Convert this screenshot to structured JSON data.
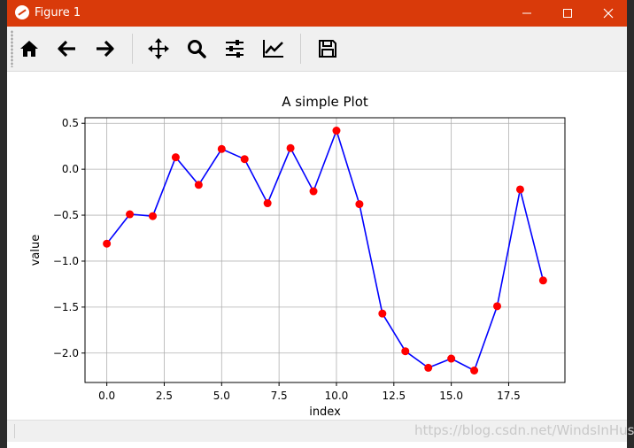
{
  "window": {
    "title": "Figure 1",
    "controls": {
      "minimize": "─",
      "maximize": "☐",
      "close": "✕"
    }
  },
  "toolbar": {
    "buttons": [
      {
        "name": "home-icon"
      },
      {
        "name": "back-arrow-icon"
      },
      {
        "name": "forward-arrow-icon"
      },
      {
        "name": "pan-icon"
      },
      {
        "name": "zoom-icon"
      },
      {
        "name": "subplots-config-icon"
      },
      {
        "name": "edit-axis-icon"
      },
      {
        "name": "save-icon"
      }
    ]
  },
  "status": {
    "watermark": "https://blog.csdn.net/WindsInHust"
  },
  "colors": {
    "titlebar": "#d93a0a",
    "line": "#0000ff",
    "marker": "#ff0000",
    "grid": "#b0b0b0"
  },
  "chart_data": {
    "type": "line",
    "title": "A simple Plot",
    "xlabel": "index",
    "ylabel": "value",
    "xlim": [
      -0.95,
      19.95
    ],
    "ylim": [
      -2.32,
      0.56
    ],
    "xticks": [
      0.0,
      2.5,
      5.0,
      7.5,
      10.0,
      12.5,
      15.0,
      17.5
    ],
    "xtick_labels": [
      "0.0",
      "2.5",
      "5.0",
      "7.5",
      "10.0",
      "12.5",
      "15.0",
      "17.5"
    ],
    "yticks": [
      0.5,
      0.0,
      -0.5,
      -1.0,
      -1.5,
      -2.0
    ],
    "ytick_labels": [
      "0.5",
      "0.0",
      "−0.5",
      "−1.0",
      "−1.5",
      "−2.0"
    ],
    "grid": true,
    "series": [
      {
        "x": [
          0,
          1,
          2,
          3,
          4,
          5,
          6,
          7,
          8,
          9,
          10,
          11,
          12,
          13,
          14,
          15,
          16,
          17,
          18,
          19
        ],
        "values": [
          -0.81,
          -0.49,
          -0.51,
          0.13,
          -0.17,
          0.22,
          0.11,
          -0.37,
          0.23,
          -0.24,
          0.42,
          -0.38,
          -1.57,
          -1.98,
          -2.16,
          -2.06,
          -2.19,
          -1.49,
          -0.22,
          -1.21
        ],
        "line_color": "blue",
        "marker_color": "red",
        "marker": "o"
      }
    ]
  }
}
